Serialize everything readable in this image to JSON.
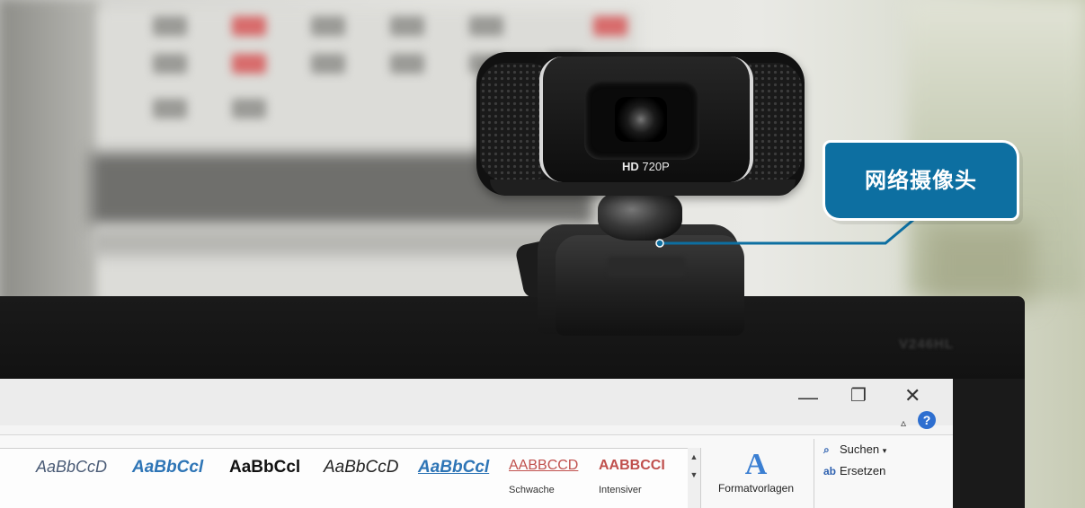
{
  "callout": {
    "label": "网络摄像头",
    "color": "#0d6fa1"
  },
  "webcam": {
    "model_label_bold": "HD",
    "model_label": " 720P"
  },
  "monitor": {
    "brand": "V246HL"
  },
  "window_controls": {
    "minimize": "—",
    "restore": "❐",
    "close": "✕",
    "collapse_ribbon": "▵",
    "help": "?"
  },
  "ribbon": {
    "styles": [
      {
        "sample": "AaBbCcD",
        "label": ""
      },
      {
        "sample": "AaBbCcl",
        "label": ""
      },
      {
        "sample": "AaBbCcl",
        "label": ""
      },
      {
        "sample": "AaBbCcD",
        "label": ""
      },
      {
        "sample": "AaBbCcl",
        "label": ""
      },
      {
        "sample": "AABBCCD",
        "label": "Schwache"
      },
      {
        "sample": "AABBCCI",
        "label": "Intensiver"
      }
    ],
    "formatvorlagen": {
      "icon": "A",
      "label": "Formatvorlagen"
    },
    "editing": {
      "search": "Suchen",
      "replace": "Ersetzen"
    }
  }
}
